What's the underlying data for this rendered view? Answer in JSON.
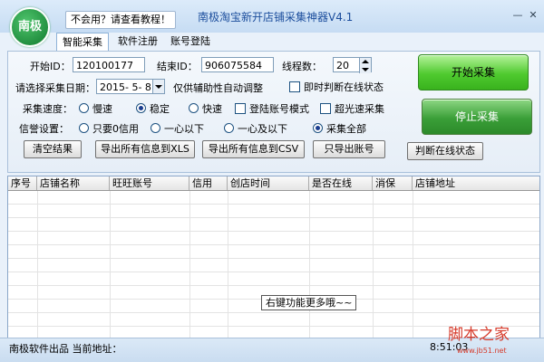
{
  "titlebar": {
    "logo_text": "南极",
    "help_link": "不会用？请查看教程！",
    "title": "南极淘宝新开店铺采集神器V4.1",
    "minimize_glyph": "—",
    "close_glyph": "✕"
  },
  "tabs": [
    {
      "label": "智能采集",
      "active": true
    },
    {
      "label": "软件注册",
      "active": false
    },
    {
      "label": "账号登陆",
      "active": false
    }
  ],
  "form": {
    "start_id_label": "开始ID：",
    "start_id_value": "120100177",
    "end_id_label": "结束ID：",
    "end_id_value": "906075584",
    "threads_label": "线程数：",
    "threads_value": "20",
    "date_label": "请选择采集日期：",
    "date_value": "2015- 5- 8",
    "date_hint": "仅供辅助性自动调整",
    "online_check_label": "即时判断在线状态",
    "online_check_checked": false,
    "speed_label": "采集速度：",
    "speed_options": [
      {
        "label": "慢速",
        "selected": false
      },
      {
        "label": "稳定",
        "selected": true
      },
      {
        "label": "快速",
        "selected": false
      }
    ],
    "login_mode_label": "登陆账号模式",
    "login_mode_checked": false,
    "ultra_fast_label": "超光速采集",
    "ultra_fast_checked": false,
    "credit_label": "信誉设置：",
    "credit_options": [
      {
        "label": "只要0信用",
        "selected": false
      },
      {
        "label": "一心以下",
        "selected": false
      },
      {
        "label": "一心及以下",
        "selected": false
      },
      {
        "label": "采集全部",
        "selected": true
      }
    ]
  },
  "buttons": {
    "clear": "清空结果",
    "export_xls": "导出所有信息到XLS",
    "export_csv": "导出所有信息到CSV",
    "export_accounts": "只导出账号",
    "check_online": "判断在线状态",
    "start": "开始采集",
    "stop": "停止采集"
  },
  "table": {
    "columns": [
      "序号",
      "店铺名称",
      "旺旺账号",
      "信用",
      "创店时间",
      "是否在线",
      "消保",
      "店铺地址"
    ],
    "rows": [],
    "context_tip": "右键功能更多哦~~"
  },
  "statusbar": {
    "text": "南极软件出品  当前地址：",
    "time": "8:51:03"
  },
  "watermark": {
    "text": "脚本之家",
    "url": "www.jb51.net"
  },
  "colors": {
    "accent": "#1b4d9c",
    "start_green": "#4fca2f",
    "stop_green": "#3a9f38",
    "watermark_red": "#d63a2a"
  }
}
